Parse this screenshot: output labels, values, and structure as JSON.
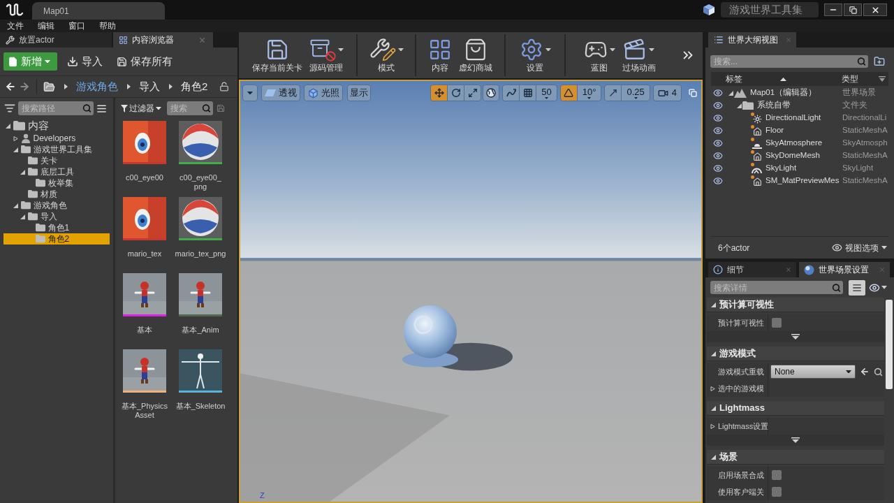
{
  "title_bar": {
    "document_tab": "Map01",
    "project_name": "游戏世界工具集"
  },
  "menu_bar": [
    {
      "label": "文件"
    },
    {
      "label": "编辑"
    },
    {
      "label": "窗口"
    },
    {
      "label": "帮助"
    }
  ],
  "left_tabs": [
    {
      "label": "放置actor",
      "kind": "place",
      "selected": false
    },
    {
      "label": "内容浏览器",
      "kind": "content",
      "selected": true
    }
  ],
  "content_browser": {
    "toolbar": {
      "add": "新增",
      "import": "导入",
      "save_all": "保存所有"
    },
    "path": [
      {
        "label": "游戏角色",
        "hovered": true
      },
      {
        "label": "导入",
        "hovered": false
      },
      {
        "label": "角色2",
        "hovered": false
      }
    ],
    "path_search": {
      "placeholder": "搜索路径"
    },
    "tree": [
      {
        "label": "内容",
        "kind": "folder",
        "expanded": true,
        "selected": false,
        "children": [
          {
            "label": "Developers",
            "kind": "user",
            "expanded": false,
            "selected": false
          },
          {
            "label": "游戏世界工具集",
            "kind": "folder",
            "expanded": true,
            "selected": false,
            "children": [
              {
                "label": "关卡",
                "kind": "folder",
                "selected": false
              },
              {
                "label": "底层工具",
                "kind": "folder",
                "expanded": true,
                "selected": false,
                "children": [
                  {
                    "label": "枚举集",
                    "kind": "folder",
                    "selected": false
                  }
                ]
              },
              {
                "label": "材质",
                "kind": "folder",
                "selected": false
              }
            ]
          },
          {
            "label": "游戏角色",
            "kind": "folder",
            "expanded": true,
            "selected": false,
            "children": [
              {
                "label": "导入",
                "kind": "folder",
                "expanded": true,
                "selected": false,
                "children": [
                  {
                    "label": "角色1",
                    "kind": "folder",
                    "selected": false
                  },
                  {
                    "label": "角色2",
                    "kind": "folder",
                    "selected": true
                  }
                ]
              }
            ]
          }
        ]
      }
    ],
    "filter": {
      "label": "过滤器"
    },
    "asset_search": {
      "placeholder": "搜索"
    },
    "assets": [
      {
        "label": "c00_eye00",
        "kind": "texture",
        "color": "#c43a32"
      },
      {
        "label": "c00_eye00_png",
        "kind": "material",
        "color": "#3fae49"
      },
      {
        "label": "mario_tex",
        "kind": "texture",
        "color": "#c43a32"
      },
      {
        "label": "mario_tex_png",
        "kind": "material",
        "color": "#3fae49"
      },
      {
        "label": "基本",
        "kind": "skeletal_mesh",
        "color": "#e020e0"
      },
      {
        "label": "基本_Anim",
        "kind": "animation",
        "color": "#4f6b4f"
      },
      {
        "label": "基本_PhysicsAsset",
        "kind": "physics_asset",
        "color": "#f0b27a"
      },
      {
        "label": "基本_Skeleton",
        "kind": "skeleton",
        "color": "#58b4d8"
      }
    ]
  },
  "main_toolbar": {
    "groups": [
      {
        "buttons": [
          {
            "label": "保存当前关卡",
            "kind": "save",
            "dropdown": false
          },
          {
            "label": "源码管理",
            "kind": "source",
            "dropdown": true
          }
        ]
      },
      {
        "buttons": [
          {
            "label": "模式",
            "kind": "modes",
            "dropdown": true
          }
        ]
      },
      {
        "buttons": [
          {
            "label": "内容",
            "kind": "content",
            "dropdown": false
          },
          {
            "label": "虚幻商城",
            "kind": "marketplace",
            "dropdown": false
          }
        ]
      },
      {
        "buttons": [
          {
            "label": "设置",
            "kind": "settings",
            "dropdown": true
          }
        ]
      },
      {
        "buttons": [
          {
            "label": "蓝图",
            "kind": "blueprints",
            "dropdown": true
          },
          {
            "label": "过场动画",
            "kind": "cinematics",
            "dropdown": true
          }
        ]
      }
    ]
  },
  "viewport": {
    "view_mode": "透视",
    "lighting": "光照",
    "show": "显示",
    "transform_tools": [
      {
        "kind": "translate",
        "selected": true
      },
      {
        "kind": "rotate",
        "selected": false
      },
      {
        "kind": "scale",
        "selected": false
      }
    ],
    "snaps": [
      {
        "kind": "grid",
        "on": false,
        "value": "50"
      },
      {
        "kind": "rotation",
        "on": true,
        "value": "10°"
      },
      {
        "kind": "scale",
        "on": false,
        "value": "0.25"
      }
    ],
    "camera_speed": "4",
    "axis_label": "Z"
  },
  "outliner": {
    "tab": "世界大纲视图",
    "search": {
      "placeholder": "搜索..."
    },
    "columns": [
      {
        "label": "标签"
      },
      {
        "label": "类型"
      }
    ],
    "rows": [
      {
        "label": "Map01（编辑器）",
        "type": "世界场景",
        "kind": "world",
        "visible": true,
        "expanded": true,
        "children": [
          {
            "label": "系统自带",
            "type": "文件夹",
            "kind": "folder",
            "visible": true,
            "expanded": true,
            "children": [
              {
                "label": "DirectionalLight",
                "type": "DirectionalLi",
                "kind": "light",
                "visible": true
              },
              {
                "label": "Floor",
                "type": "StaticMeshA",
                "kind": "mesh",
                "visible": true
              },
              {
                "label": "SkyAtmosphere",
                "type": "SkyAtmosph",
                "kind": "atmosphere",
                "visible": true
              },
              {
                "label": "SkyDomeMesh",
                "type": "StaticMeshA",
                "kind": "mesh",
                "visible": true
              },
              {
                "label": "SkyLight",
                "type": "SkyLight",
                "kind": "skylight",
                "visible": true
              },
              {
                "label": "SM_MatPreviewMes",
                "type": "StaticMeshA",
                "kind": "mesh",
                "visible": true
              }
            ]
          }
        ]
      }
    ],
    "actor_count": "6个actor",
    "view_options": "视图选项"
  },
  "details": {
    "tabs": [
      {
        "label": "细节",
        "kind": "info",
        "selected": false
      },
      {
        "label": "世界场景设置",
        "kind": "world",
        "selected": true
      }
    ],
    "search": {
      "placeholder": "搜索详情"
    },
    "sections": [
      {
        "title": "预计算可视性",
        "expanded": true,
        "advanced": true,
        "rows": [
          {
            "kind": "checkbox",
            "label": "预计算可视性",
            "checked": false
          }
        ]
      },
      {
        "title": "游戏模式",
        "expanded": true,
        "rows": [
          {
            "kind": "dropdown",
            "label": "游戏模式重载",
            "value": "None"
          },
          {
            "kind": "group",
            "label": "选中的游戏模",
            "expanded": false
          }
        ]
      },
      {
        "title": "Lightmass",
        "expanded": true,
        "advanced": true,
        "rows": [
          {
            "kind": "group",
            "label": "Lightmass设置",
            "expanded": false
          }
        ]
      },
      {
        "title": "场景",
        "expanded": true,
        "rows": [
          {
            "kind": "checkbox",
            "label": "启用场景合成",
            "checked": false
          },
          {
            "kind": "checkbox",
            "label": "使用客户端关",
            "checked": false
          }
        ]
      }
    ]
  }
}
